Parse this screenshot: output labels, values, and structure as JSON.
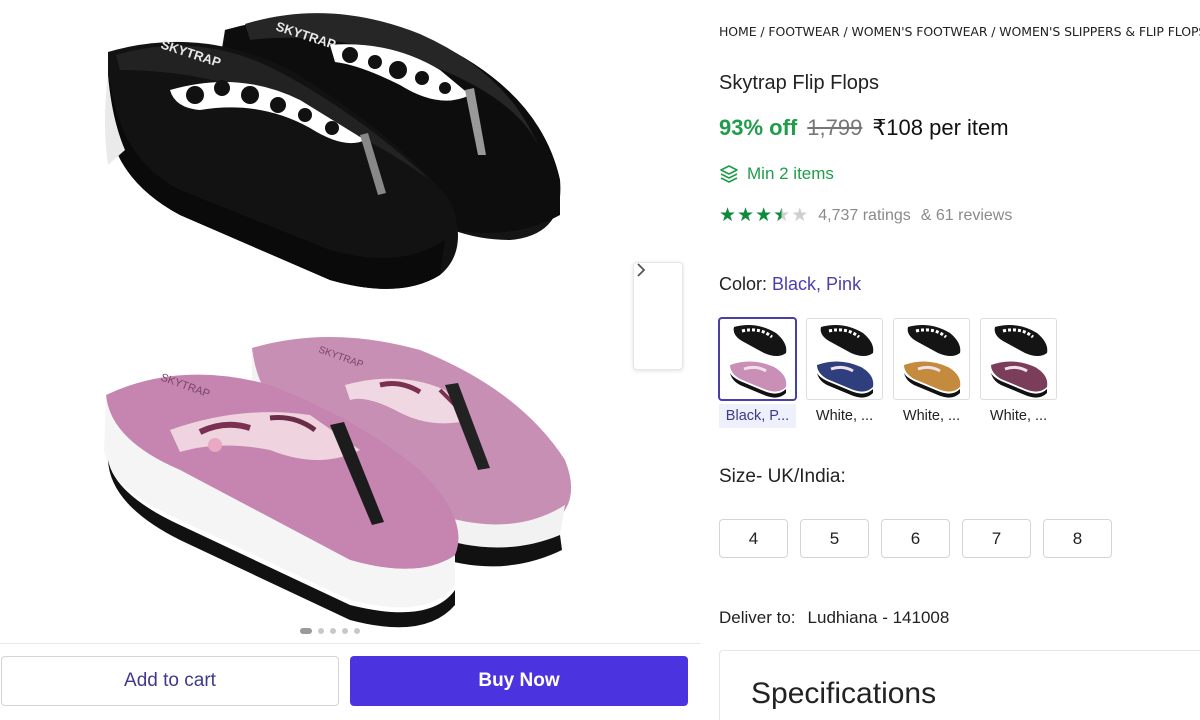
{
  "gallery": {
    "dots_count": 5,
    "active_dot": 0
  },
  "actions": {
    "add_to_cart": "Add to cart",
    "buy_now": "Buy Now"
  },
  "product": {
    "breadcrumb": [
      "HOME",
      "FOOTWEAR",
      "WOMEN'S FOOTWEAR",
      "WOMEN'S SLIPPERS & FLIP FLOPS"
    ],
    "breadcrumb_separator": " / ",
    "title": "Skytrap Flip Flops",
    "discount": "93% off",
    "mrp": "1,799",
    "price": "₹108 per item",
    "min_items": "Min 2 items",
    "rating": 3.5,
    "ratings_text": "4,737 ratings",
    "reviews_text": "& 61 reviews",
    "color_label": "Color:",
    "color_value": "Black, Pink",
    "swatches": [
      {
        "label": "Black, P...",
        "selected": true,
        "bottom_color": "#c98fb7"
      },
      {
        "label": "White, ...",
        "selected": false,
        "bottom_color": "#2f3f7e"
      },
      {
        "label": "White, ...",
        "selected": false,
        "bottom_color": "#c48a3e"
      },
      {
        "label": "White, ...",
        "selected": false,
        "bottom_color": "#7a3e5a"
      }
    ],
    "size_label": "Size- UK/India:",
    "sizes": [
      "4",
      "5",
      "6",
      "7",
      "8"
    ],
    "deliver_label": "Deliver to:",
    "deliver_location": "Ludhiana - 141008",
    "spec_title": "Specifications"
  },
  "colors": {
    "accent": "#4b34e0",
    "green": "#1f9d4a",
    "link": "#4b3fb0"
  }
}
